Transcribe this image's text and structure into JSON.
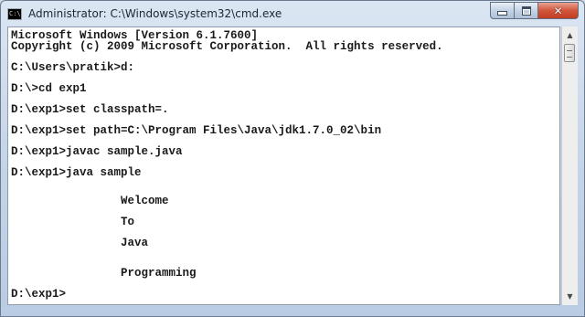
{
  "window": {
    "title": "Administrator: C:\\Windows\\system32\\cmd.exe",
    "icon": "cmd-icon",
    "icon_text": "C:\\.",
    "controls": {
      "minimize": "minimize-icon",
      "maximize": "maximize-icon",
      "close": "close-icon",
      "close_glyph": "✕"
    }
  },
  "console": {
    "lines": [
      "Microsoft Windows [Version 6.1.7600]",
      "Copyright (c) 2009 Microsoft Corporation.  All rights reserved.",
      "C:\\Users\\pratik>d:",
      "D:\\>cd exp1",
      "D:\\exp1>set classpath=.",
      "D:\\exp1>set path=C:\\Program Files\\Java\\jdk1.7.0_02\\bin",
      "D:\\exp1>javac sample.java",
      "D:\\exp1>java sample",
      "                Welcome",
      "                To",
      "                Java",
      "                Programming",
      "D:\\exp1>"
    ]
  },
  "scrollbar": {
    "up": "▲",
    "down": "▼"
  }
}
